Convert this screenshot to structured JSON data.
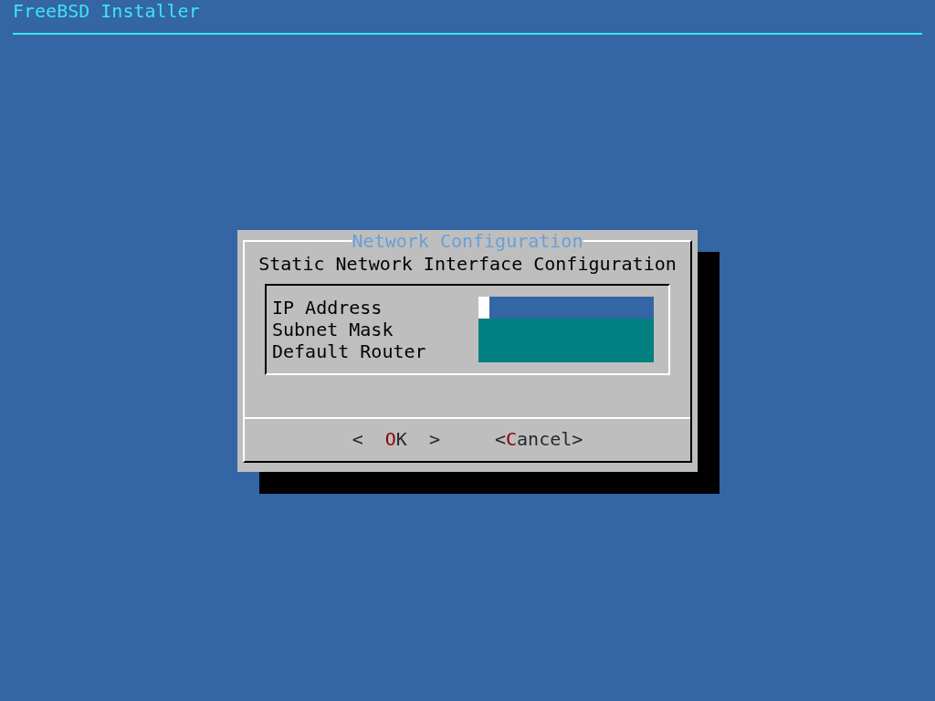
{
  "header": {
    "title": "FreeBSD Installer"
  },
  "dialog": {
    "title": "Network Configuration",
    "prompt": "Static Network Interface Configuration",
    "fields": [
      {
        "label": "IP Address",
        "focused": true
      },
      {
        "label": "Subnet Mask",
        "focused": false
      },
      {
        "label": "Default Router",
        "focused": false
      }
    ],
    "buttons": [
      {
        "left": "<",
        "hotkey": "O",
        "rest": "K",
        "right": ">",
        "selected": false,
        "kind": "ok"
      },
      {
        "left": "<",
        "hotkey": "C",
        "rest": "ancel",
        "right": ">",
        "selected": false,
        "kind": "cancel"
      }
    ]
  }
}
